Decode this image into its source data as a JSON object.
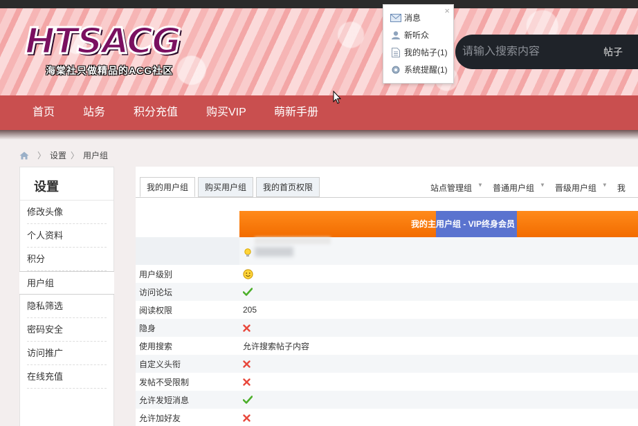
{
  "header": {
    "logo_text": "HTSACG",
    "logo_slogan": "海棠社只做精品的ACG社区",
    "search_placeholder": "请输入搜索内容",
    "search_type": "帖子"
  },
  "notify_menu": {
    "items": [
      {
        "label": "消息",
        "count": "",
        "icon": "envelope-icon"
      },
      {
        "label": "新听众",
        "count": "",
        "icon": "user-icon"
      },
      {
        "label": "我的帖子",
        "count": "(1)",
        "icon": "document-icon"
      },
      {
        "label": "系统提醒",
        "count": "(1)",
        "icon": "gear-icon"
      }
    ]
  },
  "nav": {
    "items": [
      "首页",
      "站务",
      "积分充值",
      "购买VIP",
      "萌新手册"
    ]
  },
  "breadcrumb": {
    "items": [
      "设置",
      "用户组"
    ]
  },
  "sidebar": {
    "title": "设置",
    "items": [
      "修改头像",
      "个人资料",
      "积分",
      "用户组",
      "隐私筛选",
      "密码安全",
      "访问推广",
      "在线充值"
    ],
    "active_index": 3
  },
  "tabs": [
    "我的用户组",
    "购买用户组",
    "我的首页权限"
  ],
  "group_links": [
    "站点管理组",
    "普通用户组",
    "晋级用户组",
    "我"
  ],
  "group_header": "我的主用户组 - VIP终身会员",
  "permissions": [
    {
      "key": "用户级别",
      "value": "",
      "icon": "smiley-icon"
    },
    {
      "key": "访问论坛",
      "value": "",
      "icon": "check-icon"
    },
    {
      "key": "阅读权限",
      "value": "205",
      "icon": ""
    },
    {
      "key": "隐身",
      "value": "",
      "icon": "cross-icon"
    },
    {
      "key": "使用搜索",
      "value": "允许搜索帖子内容",
      "icon": ""
    },
    {
      "key": "自定义头衔",
      "value": "",
      "icon": "cross-icon"
    },
    {
      "key": "发帖不受限制",
      "value": "",
      "icon": "cross-icon"
    },
    {
      "key": "允许发短消息",
      "value": "",
      "icon": "check-icon"
    },
    {
      "key": "允许加好友",
      "value": "",
      "icon": "cross-icon"
    }
  ],
  "colors": {
    "nav_bg": "#c94f4f",
    "group_orange": "#f26c00",
    "group_vip_blue": "#5a73cf",
    "check_green": "#4caf2a",
    "cross_red": "#e8473b"
  }
}
